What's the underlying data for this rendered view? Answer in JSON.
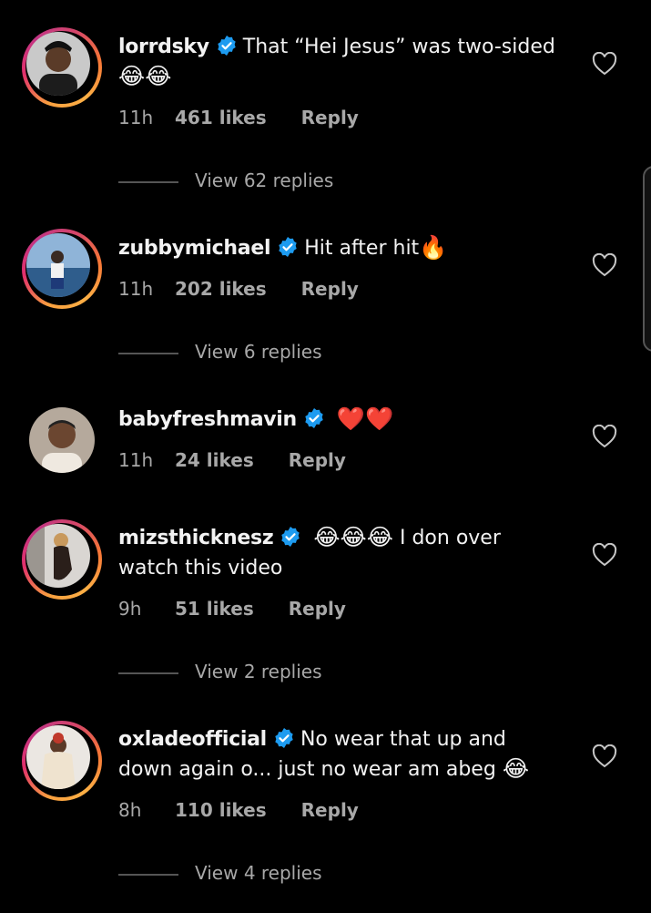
{
  "comments": [
    {
      "username": "lorrdsky",
      "text": "That “Hei Jesus” was two-sided",
      "emojis": "😂😂",
      "time": "11h",
      "likes": "461 likes",
      "reply": "Reply",
      "view_replies": "View 62 replies"
    },
    {
      "username": "zubbymichael",
      "text": "Hit after hit",
      "emojis": "🔥",
      "time": "11h",
      "likes": "202 likes",
      "reply": "Reply",
      "view_replies": "View 6 replies"
    },
    {
      "username": "babyfreshmavin",
      "text": "",
      "emojis": "❤️❤️",
      "time": "11h",
      "likes": "24 likes",
      "reply": "Reply",
      "view_replies": ""
    },
    {
      "username": "mizsthicknesz",
      "pre_emojis": "😂😂😂",
      "text": "I don over watch this video",
      "time": "9h",
      "likes": "51 likes",
      "reply": "Reply",
      "view_replies": "View 2 replies"
    },
    {
      "username": "oxladeofficial",
      "text": "No wear that up and down again o... just no wear am abeg",
      "emojis": "😂",
      "time": "8h",
      "likes": "110 likes",
      "reply": "Reply",
      "view_replies": "View 4 replies"
    }
  ],
  "icons": {
    "verified": "verified-badge-icon",
    "like": "heart-outline-icon"
  },
  "colors": {
    "background": "#000000",
    "verified": "#1d9bf0",
    "secondary_text": "#a8a8a8"
  }
}
